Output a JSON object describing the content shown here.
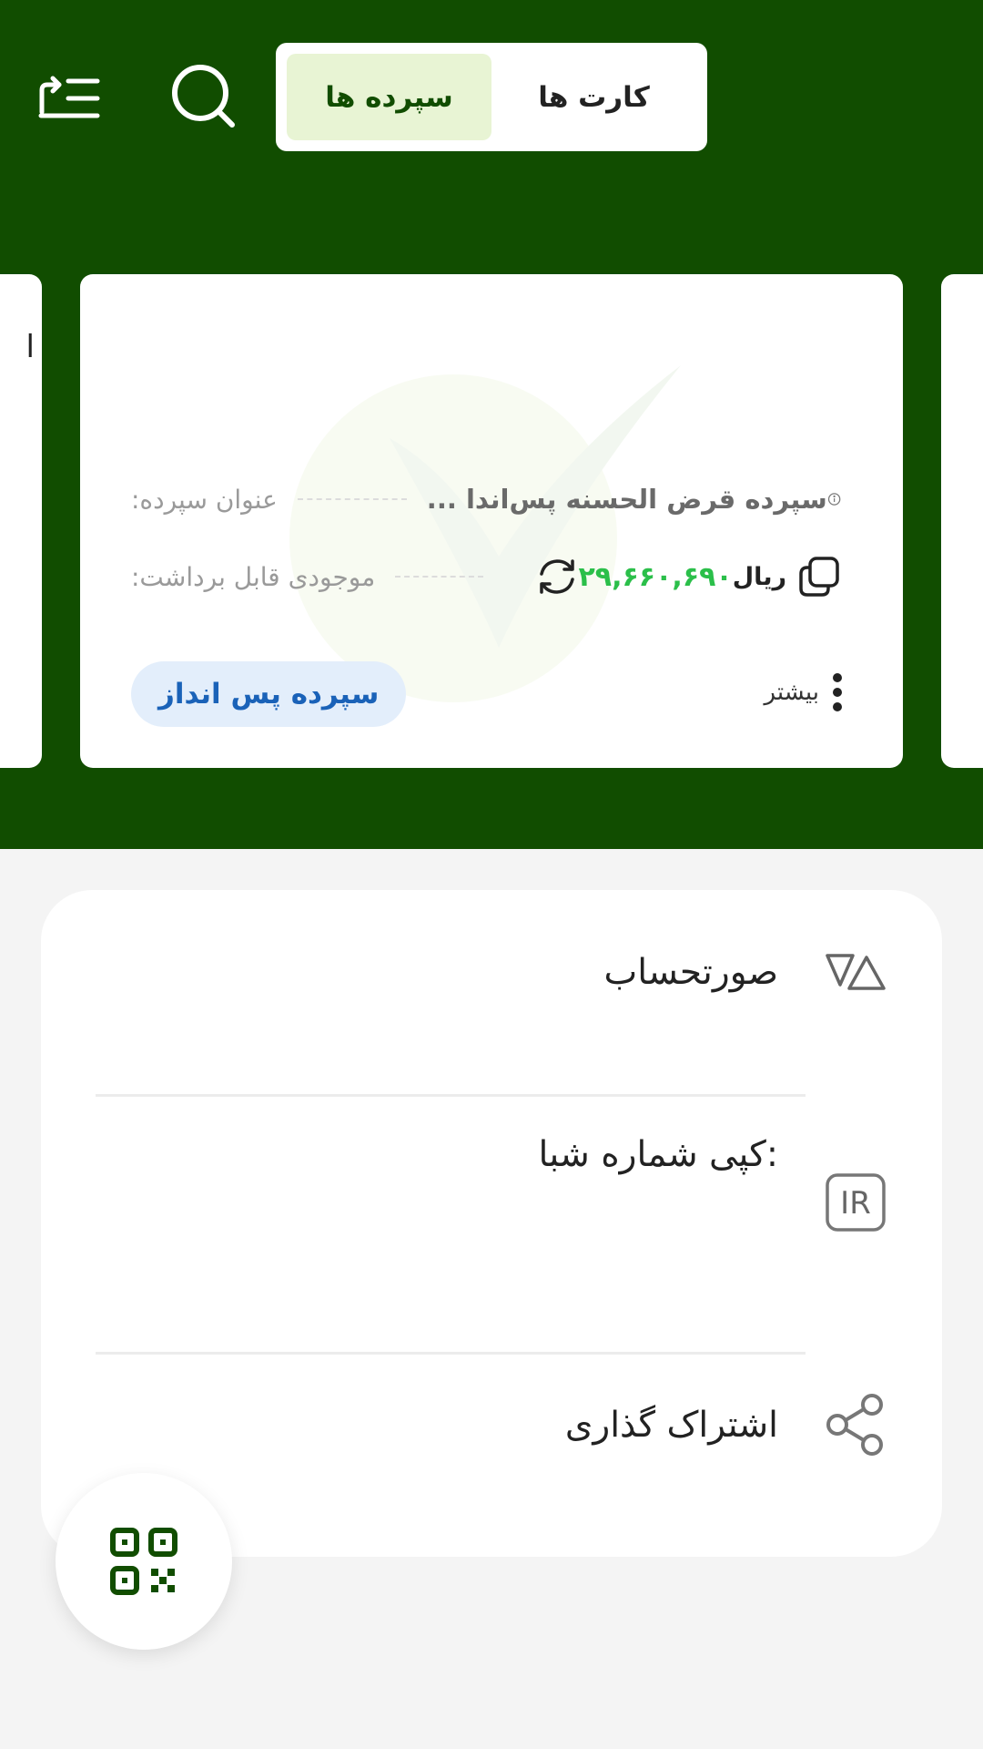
{
  "header": {
    "tabs": [
      {
        "label": "کارت ها",
        "active": false
      },
      {
        "label": "سپرده ها",
        "active": true
      }
    ],
    "menu_icon": "list-swap-icon",
    "search_icon": "search-icon",
    "background_color": "#114d00"
  },
  "card": {
    "title_label": "عنوان سپرده:",
    "title_value": "سپرده قرض الحسنه پس‌اندا ...",
    "balance_label": "موجودی قابل برداشت:",
    "balance_value": "۲۹,۶۶۰,۶۹۰",
    "currency": "ریال",
    "more_label": "بیشتر",
    "badge": "سپرده پس انداز",
    "amount_color": "#2bbf4a",
    "badge_color": "#1a62b8"
  },
  "sheet": {
    "items": [
      {
        "label": "صورتحساب",
        "icon": "statement-icon"
      },
      {
        "label": "کپی شماره شبا:",
        "icon": "iban-ir-icon"
      },
      {
        "label": "اشتراک گذاری",
        "icon": "share-icon"
      }
    ],
    "iban_icon_text": "IR"
  },
  "fab": {
    "icon": "qr-code-icon"
  }
}
